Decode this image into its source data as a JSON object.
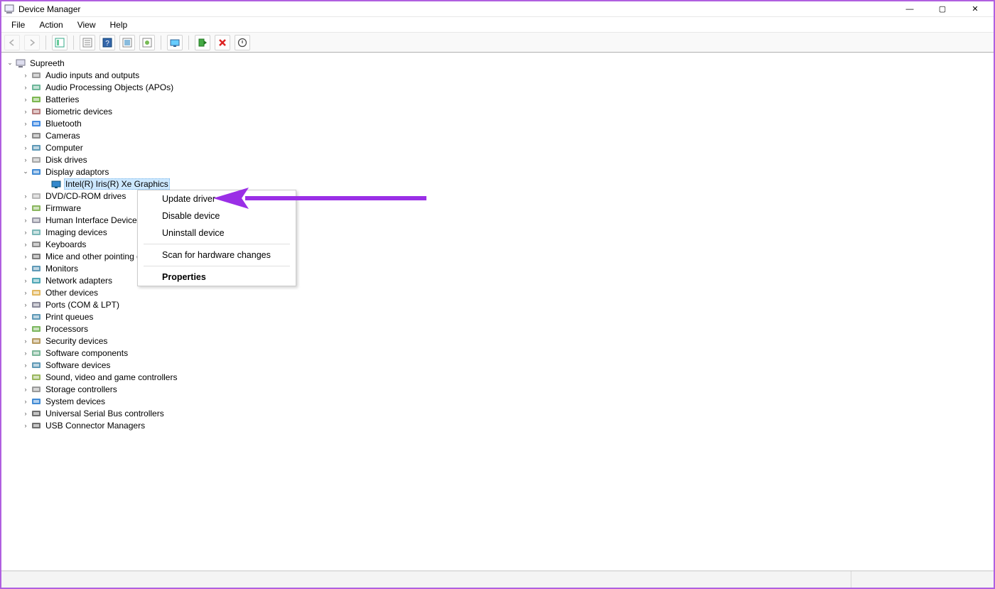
{
  "window": {
    "title": "Device Manager",
    "controls": {
      "minimize": "—",
      "maximize": "▢",
      "close": "✕"
    }
  },
  "menu": {
    "items": [
      "File",
      "Action",
      "View",
      "Help"
    ]
  },
  "tree": {
    "root": "Supreeth",
    "categories": [
      {
        "label": "Audio inputs and outputs"
      },
      {
        "label": "Audio Processing Objects (APOs)"
      },
      {
        "label": "Batteries"
      },
      {
        "label": "Biometric devices"
      },
      {
        "label": "Bluetooth"
      },
      {
        "label": "Cameras"
      },
      {
        "label": "Computer"
      },
      {
        "label": "Disk drives"
      },
      {
        "label": "Display adaptors",
        "expanded": true,
        "child": "Intel(R) Iris(R) Xe Graphics"
      },
      {
        "label": "DVD/CD-ROM drives"
      },
      {
        "label": "Firmware"
      },
      {
        "label": "Human Interface Devices"
      },
      {
        "label": "Imaging devices"
      },
      {
        "label": "Keyboards"
      },
      {
        "label": "Mice and other pointing devices"
      },
      {
        "label": "Monitors"
      },
      {
        "label": "Network adapters"
      },
      {
        "label": "Other devices"
      },
      {
        "label": "Ports (COM & LPT)"
      },
      {
        "label": "Print queues"
      },
      {
        "label": "Processors"
      },
      {
        "label": "Security devices"
      },
      {
        "label": "Software components"
      },
      {
        "label": "Software devices"
      },
      {
        "label": "Sound, video and game controllers"
      },
      {
        "label": "Storage controllers"
      },
      {
        "label": "System devices"
      },
      {
        "label": "Universal Serial Bus controllers"
      },
      {
        "label": "USB Connector Managers"
      }
    ],
    "icons": [
      "speaker",
      "gear",
      "battery",
      "fingerprint",
      "bluetooth",
      "camera",
      "monitor",
      "drive",
      "display",
      "disc",
      "chip",
      "hid",
      "imaging",
      "keyboard",
      "mouse",
      "monitor2",
      "network",
      "warning",
      "port",
      "printer",
      "cpu",
      "lock",
      "component",
      "software",
      "sound",
      "storage",
      "system",
      "usb",
      "usbconn"
    ]
  },
  "context_menu": {
    "items": [
      "Update driver",
      "Disable device",
      "Uninstall device"
    ],
    "items2": [
      "Scan for hardware changes"
    ],
    "default": "Properties"
  },
  "annotation": {
    "color": "#9a2fe6"
  }
}
